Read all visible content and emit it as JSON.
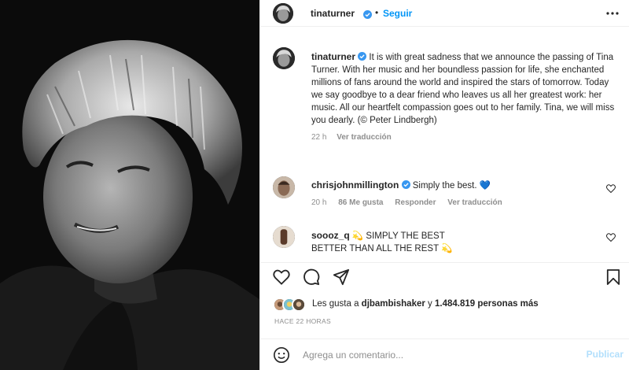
{
  "post": {
    "photo_alt": "Black and white portrait",
    "header": {
      "username": "tinaturner",
      "separator": "•",
      "follow_label": "Seguir",
      "more_icon": "more-icon"
    },
    "caption": {
      "username": "tinaturner",
      "text": "It is with great sadness that we announce the passing of Tina Turner. With her music and her boundless passion for life, she enchanted millions of fans around the world and inspired the stars of tomorrow. Today we say goodbye to a dear friend who leaves us all her greatest work: her music. All our heartfelt compassion goes out to her family. Tina, we will miss you dearly. (© Peter Lindbergh)",
      "time": "22 h",
      "translate": "Ver traducción"
    },
    "comments": [
      {
        "username": "chrisjohnmillington",
        "text": "Simply the best.",
        "emoji": "💙",
        "time": "20 h",
        "likes": "86 Me gusta",
        "reply": "Responder",
        "translate": "Ver traducción"
      },
      {
        "username": "soooz_q",
        "line1": "SIMPLY THE BEST",
        "line2": "BETTER THAN ALL THE REST",
        "sparkle": "💫"
      }
    ],
    "likes": {
      "prefix": "Les gusta a",
      "user": "djbambishaker",
      "middle": "y",
      "count": "1.484.819 personas más"
    },
    "timestamp": "HACE 22 HORAS",
    "comment_box": {
      "placeholder": "Agrega un comentario...",
      "publish": "Publicar"
    },
    "colors": {
      "accent": "#0095f6",
      "verified": "#3897f0",
      "publish_disabled": "#b2dffc",
      "muted": "#8e8e8e"
    }
  }
}
